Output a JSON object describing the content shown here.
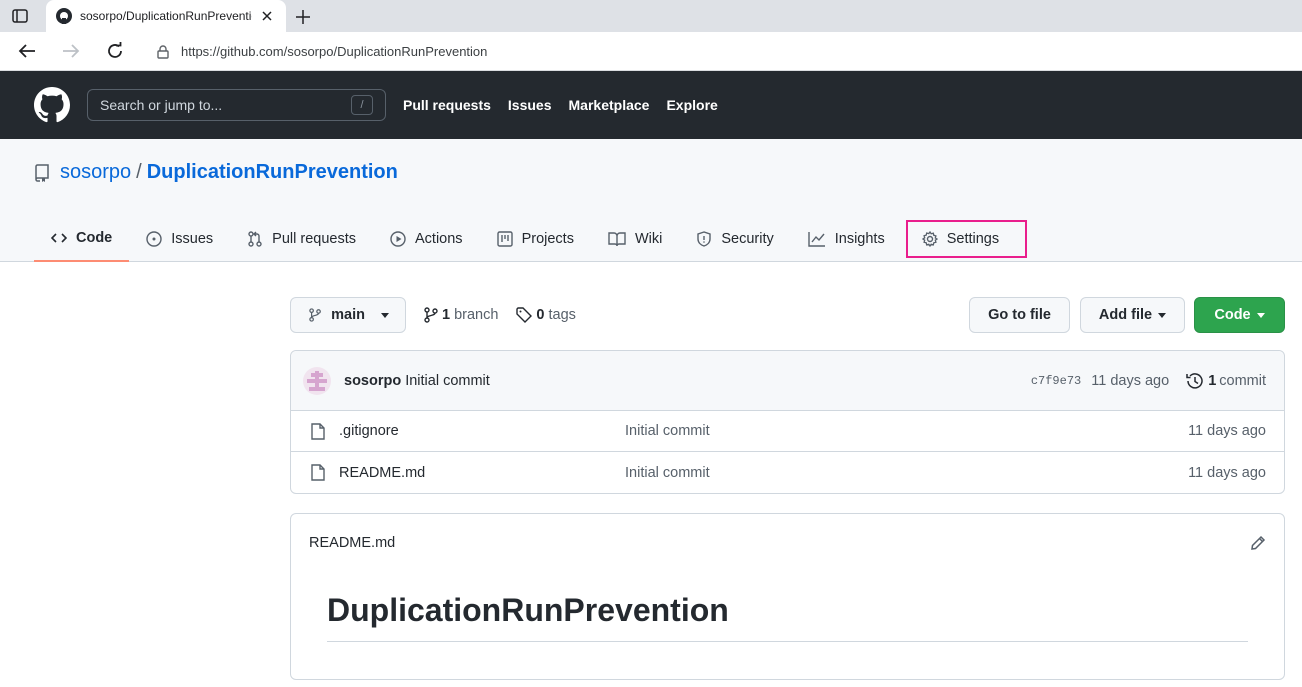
{
  "browser": {
    "tab_title": "sosorpo/DuplicationRunPrevention",
    "url": "https://github.com/sosorpo/DuplicationRunPrevention"
  },
  "header": {
    "search_placeholder": "Search or jump to...",
    "search_shortcut": "/",
    "nav": [
      "Pull requests",
      "Issues",
      "Marketplace",
      "Explore"
    ]
  },
  "repo": {
    "owner": "sosorpo",
    "separator": "/",
    "name": "DuplicationRunPrevention",
    "tabs": [
      "Code",
      "Issues",
      "Pull requests",
      "Actions",
      "Projects",
      "Wiki",
      "Security",
      "Insights",
      "Settings"
    ]
  },
  "toolbar": {
    "branch": "main",
    "branch_count": "1",
    "branch_label": "branch",
    "tag_count": "0",
    "tag_label": "tags",
    "go_to_file": "Go to file",
    "add_file": "Add file",
    "code": "Code"
  },
  "commit": {
    "author": "sosorpo",
    "message": "Initial commit",
    "sha": "c7f9e73",
    "age": "11 days ago",
    "count": "1",
    "count_label": "commit"
  },
  "files": [
    {
      "name": ".gitignore",
      "message": "Initial commit",
      "age": "11 days ago"
    },
    {
      "name": "README.md",
      "message": "Initial commit",
      "age": "11 days ago"
    }
  ],
  "readme": {
    "filename": "README.md",
    "heading": "DuplicationRunPrevention"
  },
  "colors": {
    "header_bg": "#24292f",
    "link": "#0969da",
    "code_button": "#2da44e",
    "active_tab_underline": "#fd8c73",
    "highlight_outline": "#e91e8c"
  }
}
